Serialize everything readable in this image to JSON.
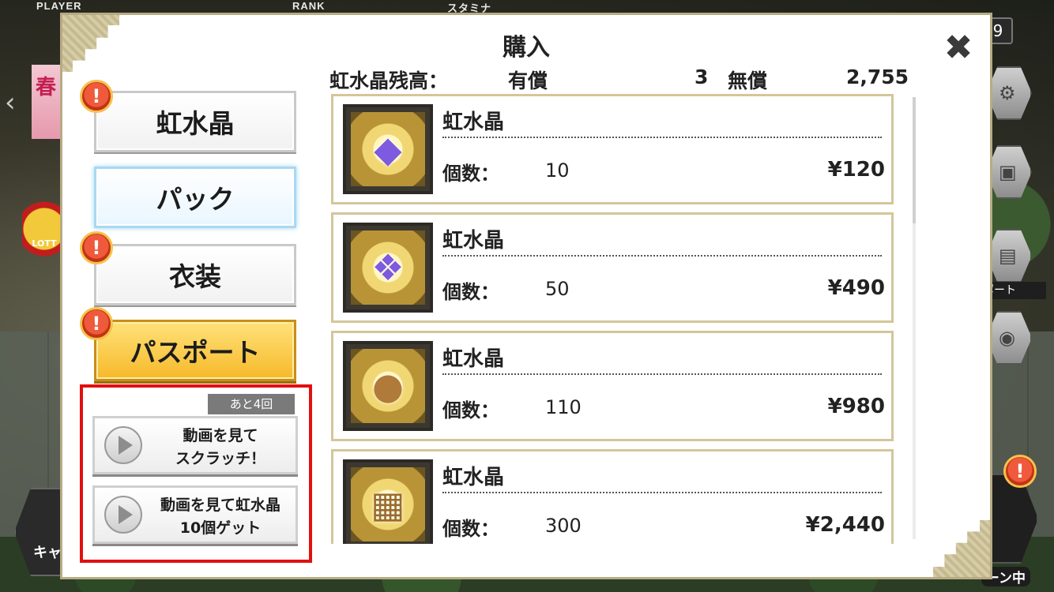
{
  "hud": {
    "player_label": "PLAYER",
    "rank_label": "RANK",
    "stamina_label": "スタミナ",
    "corner_number": "9",
    "passport_side_label": "ポート",
    "left_banner_text": "春",
    "left_badge_text": "LOTT",
    "bottom_left_label": "キャ",
    "campaign_label": "ーン中"
  },
  "modal": {
    "title": "購入",
    "close_icon": "close-icon"
  },
  "balance": {
    "label": "虹水晶残高：",
    "paid_label": "有償",
    "paid_value": "3",
    "free_label": "無償",
    "free_value": "2,755"
  },
  "menu": {
    "items": [
      {
        "label": "虹水晶",
        "alert": "!",
        "style": "normal"
      },
      {
        "label": "パック",
        "alert": "",
        "style": "active"
      },
      {
        "label": "衣装",
        "alert": "!",
        "style": "normal"
      },
      {
        "label": "パスポート",
        "alert": "!",
        "style": "gold"
      }
    ]
  },
  "video": {
    "remaining_tag": "あと4回",
    "scratch_line1": "動画を見て",
    "scratch_line2": "スクラッチ！",
    "crystal_line1": "動画を見て虹水晶",
    "crystal_line2": "10個ゲット"
  },
  "products": [
    {
      "name": "虹水晶",
      "qty_label": "個数：",
      "qty": "10",
      "price": "¥120",
      "icon": "crystal-small-icon"
    },
    {
      "name": "虹水晶",
      "qty_label": "個数：",
      "qty": "50",
      "price": "¥490",
      "icon": "crystal-cluster-icon"
    },
    {
      "name": "虹水晶",
      "qty_label": "個数：",
      "qty": "110",
      "price": "¥980",
      "icon": "crystal-bag-icon"
    },
    {
      "name": "虹水晶",
      "qty_label": "個数：",
      "qty": "300",
      "price": "¥2,440",
      "icon": "crystal-crate-icon"
    }
  ]
}
